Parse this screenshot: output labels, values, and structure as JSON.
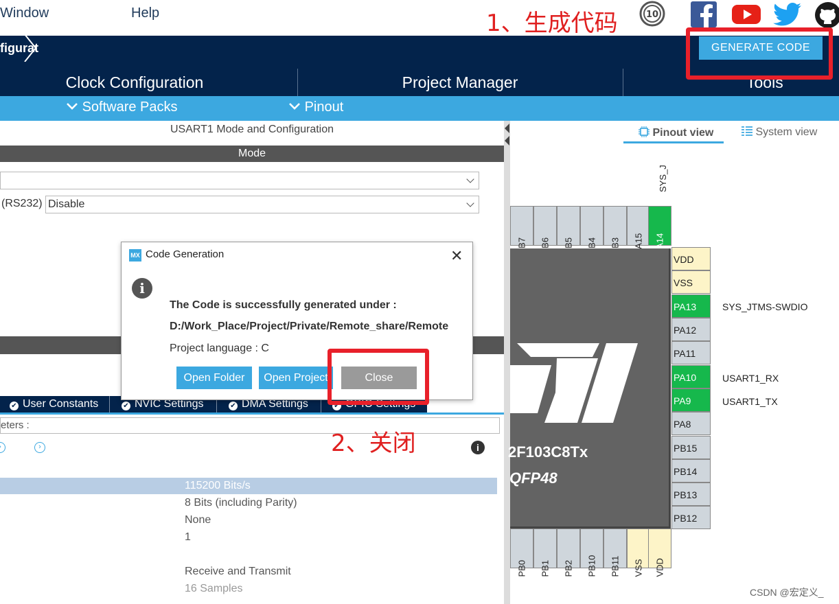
{
  "menu": {
    "window": "Window",
    "help": "Help"
  },
  "annotations": {
    "step1": "1、生成代码",
    "step2": "2、关闭"
  },
  "breadcrumb": {
    "current": "figurat"
  },
  "toolbar": {
    "generate_code": "GENERATE CODE"
  },
  "tabs": [
    "Clock Configuration",
    "Project Manager",
    "Tools"
  ],
  "subbar": {
    "software_packs": "Software Packs",
    "pinout": "Pinout"
  },
  "left": {
    "section_title": "USART1 Mode and Configuration",
    "mode_header": "Mode",
    "mode_select_value": "",
    "rs232_label": "(RS232)",
    "rs232_value": "Disable",
    "config_tabs": [
      "User Constants",
      "NVIC Settings",
      "DMA Settings",
      "GPIO Settings"
    ],
    "params_label": "eters :",
    "param_values": [
      "115200 Bits/s",
      "8 Bits (including Parity)",
      "None",
      "1",
      "Receive and Transmit",
      "16 Samples"
    ]
  },
  "right": {
    "pinout_view": "Pinout view",
    "system_view": "System view",
    "top_pins": [
      "PB7",
      "PB6",
      "PB5",
      "PB4",
      "PB3",
      "PA15",
      "PA14"
    ],
    "top_label": "SYS_J",
    "right_pins": [
      "VDD",
      "VSS",
      "PA13",
      "PA12",
      "PA11",
      "PA10",
      "PA9",
      "PA8",
      "PB15",
      "PB14",
      "PB13",
      "PB12"
    ],
    "right_labels": {
      "PA13": "SYS_JTMS-SWDIO",
      "PA10": "USART1_RX",
      "PA9": "USART1_TX"
    },
    "bottom_pins": [
      "PB0",
      "PB1",
      "PB2",
      "PB10",
      "PB11",
      "VSS",
      "VDD"
    ],
    "chip_name": "2F103C8Tx",
    "chip_package": "QFP48"
  },
  "dialog": {
    "icon": "MX",
    "title": "Code Generation",
    "message": "The Code is successfully generated under :",
    "path": "D:/Work_Place/Project/Private/Remote_share/Remote",
    "language": "Project language : C",
    "open_folder": "Open Folder",
    "open_project": "Open Project",
    "close": "Close"
  },
  "watermark": "CSDN @宏定义_",
  "colors": {
    "navy": "#03234b",
    "accent": "#3ca8e0",
    "pin_green": "#16b84c",
    "annotation_red": "#e8202a"
  }
}
